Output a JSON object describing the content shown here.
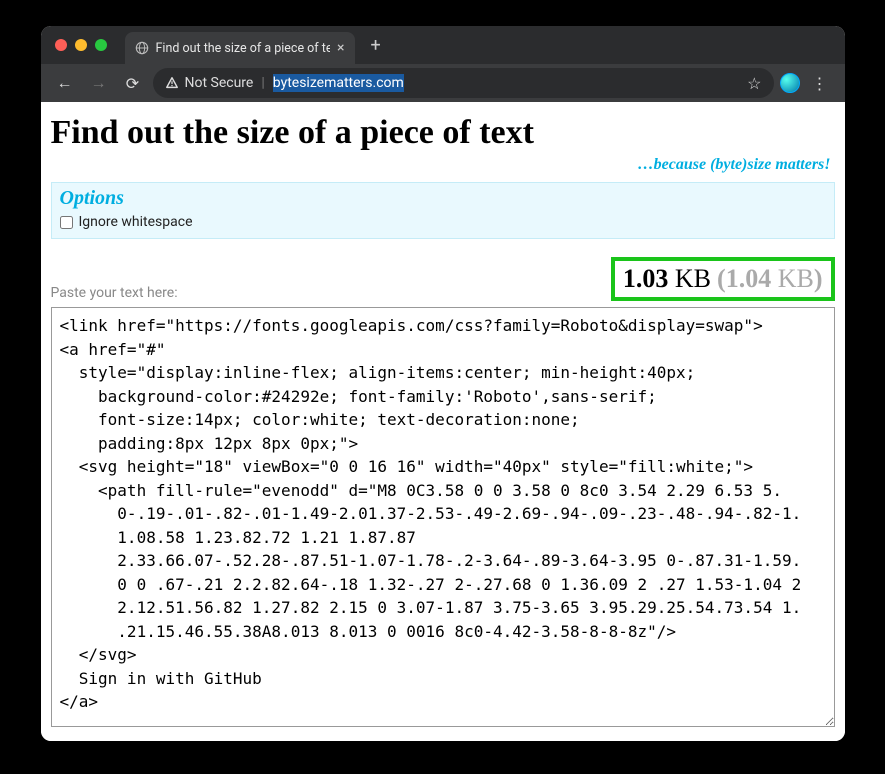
{
  "browser": {
    "tab_title": "Find out the size of a piece of tex",
    "security_label": "Not Secure",
    "url": "bytesizematters.com",
    "newtab_glyph": "+",
    "close_glyph": "×",
    "back_glyph": "←",
    "forward_glyph": "→",
    "reload_glyph": "⟳",
    "star_glyph": "☆",
    "kebab_glyph": "⋮",
    "warn_glyph": "▲"
  },
  "page": {
    "heading": "Find out the size of a piece of text",
    "tagline": "…because (byte)size matters!",
    "options_title": "Options",
    "ignore_whitespace_label": "Ignore whitespace",
    "paste_label": "Paste your text here:",
    "size_main_num": "1.03",
    "size_main_unit": "KB",
    "size_alt_num": "1.04",
    "size_alt_unit": "KB",
    "textarea_value": "<link href=\"https://fonts.googleapis.com/css?family=Roboto&display=swap\">\n<a href=\"#\"\n  style=\"display:inline-flex; align-items:center; min-height:40px;\n    background-color:#24292e; font-family:'Roboto',sans-serif;\n    font-size:14px; color:white; text-decoration:none;\n    padding:8px 12px 8px 0px;\">\n  <svg height=\"18\" viewBox=\"0 0 16 16\" width=\"40px\" style=\"fill:white;\">\n    <path fill-rule=\"evenodd\" d=\"M8 0C3.58 0 0 3.58 0 8c0 3.54 2.29 6.53 5.\n      0-.19-.01-.82-.01-1.49-2.01.37-2.53-.49-2.69-.94-.09-.23-.48-.94-.82-1.\n      1.08.58 1.23.82.72 1.21 1.87.87\n      2.33.66.07-.52.28-.87.51-1.07-1.78-.2-3.64-.89-3.64-3.95 0-.87.31-1.59.\n      0 0 .67-.21 2.2.82.64-.18 1.32-.27 2-.27.68 0 1.36.09 2 .27 1.53-1.04 2\n      2.12.51.56.82 1.27.82 2.15 0 3.07-1.87 3.75-3.65 3.95.29.25.54.73.54 1.\n      .21.15.46.55.38A8.013 8.013 0 0016 8c0-4.42-3.58-8-8-8z\"/>\n  </svg>\n  Sign in with GitHub\n</a>"
  }
}
